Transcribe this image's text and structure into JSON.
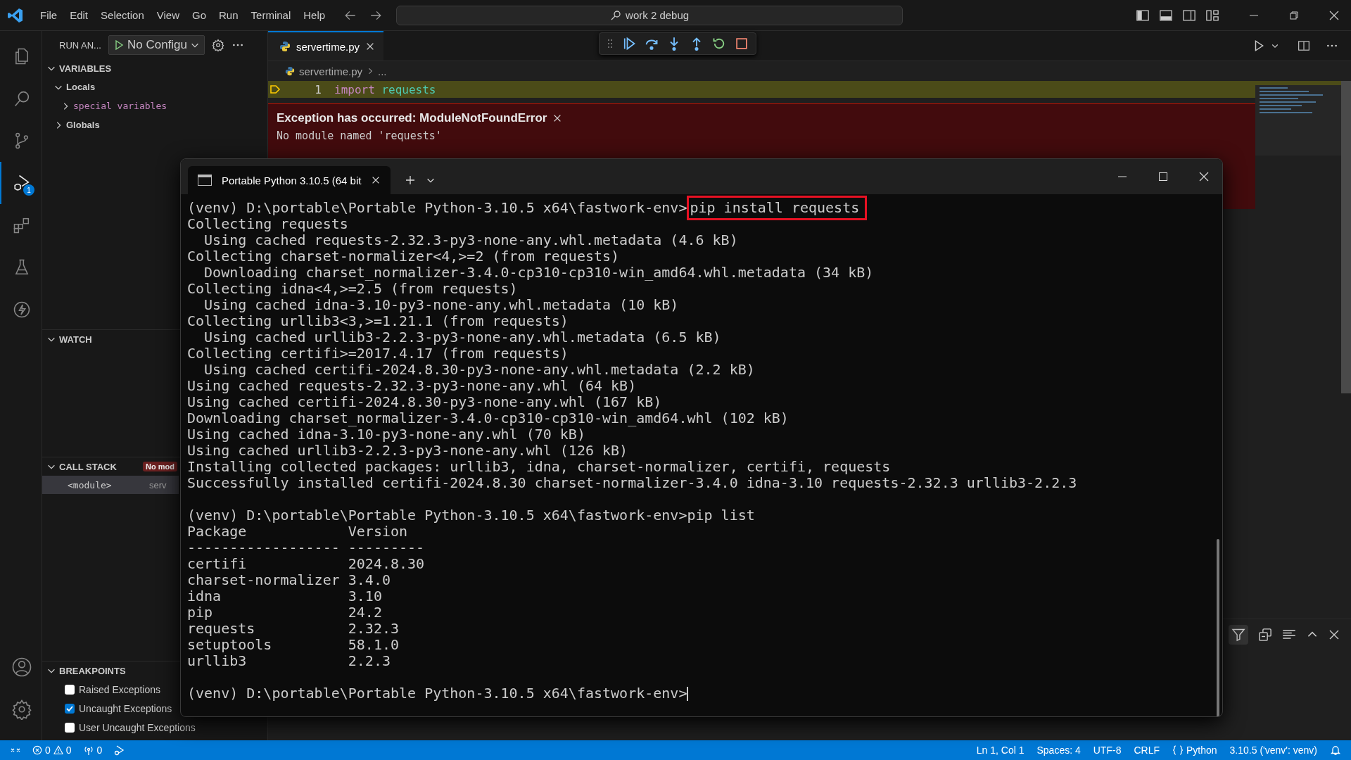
{
  "title_bar": {
    "menu": [
      "File",
      "Edit",
      "Selection",
      "View",
      "Go",
      "Run",
      "Terminal",
      "Help"
    ],
    "search": "work 2 debug"
  },
  "activity_bar": {
    "items": [
      {
        "kind": "explorer",
        "selected": false
      },
      {
        "kind": "search",
        "selected": false
      },
      {
        "kind": "source-control",
        "selected": false
      },
      {
        "kind": "debug",
        "selected": true,
        "badge": "1"
      },
      {
        "kind": "extensions",
        "selected": false
      },
      {
        "kind": "testing",
        "selected": false
      },
      {
        "kind": "lightning",
        "selected": false
      }
    ],
    "bottom": [
      {
        "kind": "account"
      },
      {
        "kind": "settings"
      }
    ]
  },
  "sidebar": {
    "title": "RUN AN...",
    "config": "No Configu",
    "variables": {
      "title": "VARIABLES",
      "expanded": true,
      "children": [
        {
          "label": "Locals",
          "expanded": true,
          "children": [
            {
              "label": "special variables",
              "expanded": false,
              "kind": "special"
            }
          ]
        },
        {
          "label": "Globals",
          "expanded": false
        }
      ]
    },
    "watch": {
      "title": "WATCH",
      "expanded": true
    },
    "call_stack": {
      "title": "CALL STACK",
      "expanded": true,
      "badge": "No mod",
      "frames": [
        {
          "name": "<module>",
          "file": "serv",
          "selected": true
        }
      ]
    },
    "breakpoints": {
      "title": "BREAKPOINTS",
      "expanded": true,
      "items": [
        {
          "label": "Raised Exceptions",
          "checked": false
        },
        {
          "label": "Uncaught Exceptions",
          "checked": true
        },
        {
          "label": "User Uncaught Exceptions",
          "checked": false
        }
      ]
    }
  },
  "editor": {
    "tabs": [
      {
        "label": "servertime.py",
        "selected": true
      }
    ],
    "breadcrumb": [
      "servertime.py",
      "..."
    ],
    "lines": [
      {
        "number": "1",
        "current": true,
        "tokens": [
          {
            "text": "import",
            "kind": "keyword"
          },
          {
            "text": "requests",
            "kind": "module"
          }
        ]
      }
    ],
    "exception": {
      "title": "Exception has occurred: ModuleNotFoundError",
      "message": "No module named 'requests'"
    }
  },
  "terminal": {
    "tabs": [
      {
        "title": "Portable Python 3.10.5 (64 bit",
        "selected": true
      }
    ],
    "lines": [
      {
        "kind": "prompt",
        "prompt": "(venv) D:\\portable\\Portable Python-3.10.5 x64\\fastwork-env>",
        "command": "pip install requests",
        "boxed": true
      },
      {
        "kind": "output",
        "text": "Collecting requests"
      },
      {
        "kind": "output",
        "text": "  Using cached requests-2.32.3-py3-none-any.whl.metadata (4.6 kB)"
      },
      {
        "kind": "output",
        "text": "Collecting charset-normalizer<4,>=2 (from requests)"
      },
      {
        "kind": "output",
        "text": "  Downloading charset_normalizer-3.4.0-cp310-cp310-win_amd64.whl.metadata (34 kB)"
      },
      {
        "kind": "output",
        "text": "Collecting idna<4,>=2.5 (from requests)"
      },
      {
        "kind": "output",
        "text": "  Using cached idna-3.10-py3-none-any.whl.metadata (10 kB)"
      },
      {
        "kind": "output",
        "text": "Collecting urllib3<3,>=1.21.1 (from requests)"
      },
      {
        "kind": "output",
        "text": "  Using cached urllib3-2.2.3-py3-none-any.whl.metadata (6.5 kB)"
      },
      {
        "kind": "output",
        "text": "Collecting certifi>=2017.4.17 (from requests)"
      },
      {
        "kind": "output",
        "text": "  Using cached certifi-2024.8.30-py3-none-any.whl.metadata (2.2 kB)"
      },
      {
        "kind": "output",
        "text": "Using cached requests-2.32.3-py3-none-any.whl (64 kB)"
      },
      {
        "kind": "output",
        "text": "Using cached certifi-2024.8.30-py3-none-any.whl (167 kB)"
      },
      {
        "kind": "output",
        "text": "Downloading charset_normalizer-3.4.0-cp310-cp310-win_amd64.whl (102 kB)"
      },
      {
        "kind": "output",
        "text": "Using cached idna-3.10-py3-none-any.whl (70 kB)"
      },
      {
        "kind": "output",
        "text": "Using cached urllib3-2.2.3-py3-none-any.whl (126 kB)"
      },
      {
        "kind": "output",
        "text": "Installing collected packages: urllib3, idna, charset-normalizer, certifi, requests"
      },
      {
        "kind": "output",
        "text": "Successfully installed certifi-2024.8.30 charset-normalizer-3.4.0 idna-3.10 requests-2.32.3 urllib3-2.2.3"
      },
      {
        "kind": "blank"
      },
      {
        "kind": "prompt",
        "prompt": "(venv) D:\\portable\\Portable Python-3.10.5 x64\\fastwork-env>",
        "command": "pip list",
        "boxed": false
      },
      {
        "kind": "output",
        "text": "Package            Version"
      },
      {
        "kind": "output",
        "text": "------------------ ---------"
      },
      {
        "kind": "output",
        "text": "certifi            2024.8.30"
      },
      {
        "kind": "output",
        "text": "charset-normalizer 3.4.0"
      },
      {
        "kind": "output",
        "text": "idna               3.10"
      },
      {
        "kind": "output",
        "text": "pip                24.2"
      },
      {
        "kind": "output",
        "text": "requests           2.32.3"
      },
      {
        "kind": "output",
        "text": "setuptools         58.1.0"
      },
      {
        "kind": "output",
        "text": "urllib3            2.2.3"
      },
      {
        "kind": "blank"
      },
      {
        "kind": "prompt",
        "prompt": "(venv) D:\\portable\\Portable Python-3.10.5 x64\\fastwork-env>",
        "cursor": true
      }
    ]
  },
  "status_bar": {
    "errors": "0",
    "warnings": "0",
    "ports": "0",
    "items": [
      {
        "text": "Ln 1, Col 1",
        "kind": "text"
      },
      {
        "text": "Spaces: 4",
        "kind": "text"
      },
      {
        "text": "UTF-8",
        "kind": "text"
      },
      {
        "text": "CRLF",
        "kind": "text"
      },
      {
        "text": "Python",
        "kind": "language"
      },
      {
        "text": "3.10.5 ('venv': venv)",
        "kind": "text"
      }
    ]
  }
}
